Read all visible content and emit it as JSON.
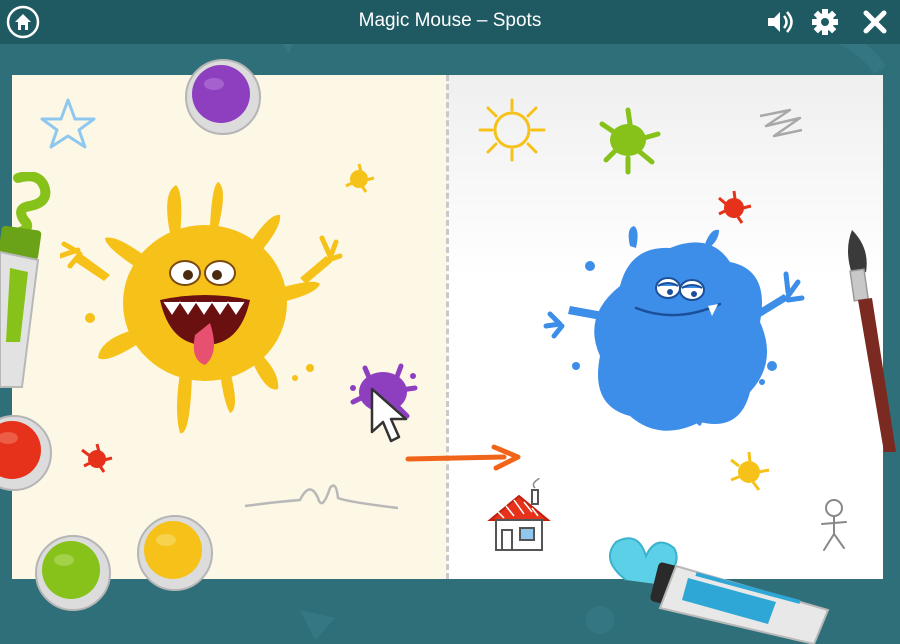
{
  "header": {
    "title": "Magic Mouse – Spots",
    "icons": {
      "home": "home-icon",
      "sound": "speaker-icon",
      "settings": "gear-icon",
      "close": "close-icon"
    }
  },
  "scene": {
    "left_page": "example-page",
    "right_page": "drawing-page",
    "paints": [
      "purple",
      "red",
      "green",
      "yellow"
    ],
    "colors": {
      "purple": "#8e3fbf",
      "red": "#e6321a",
      "green": "#86c21a",
      "yellow": "#f6c21a",
      "blue": "#3d8ee8",
      "orange": "#f0651a"
    }
  }
}
